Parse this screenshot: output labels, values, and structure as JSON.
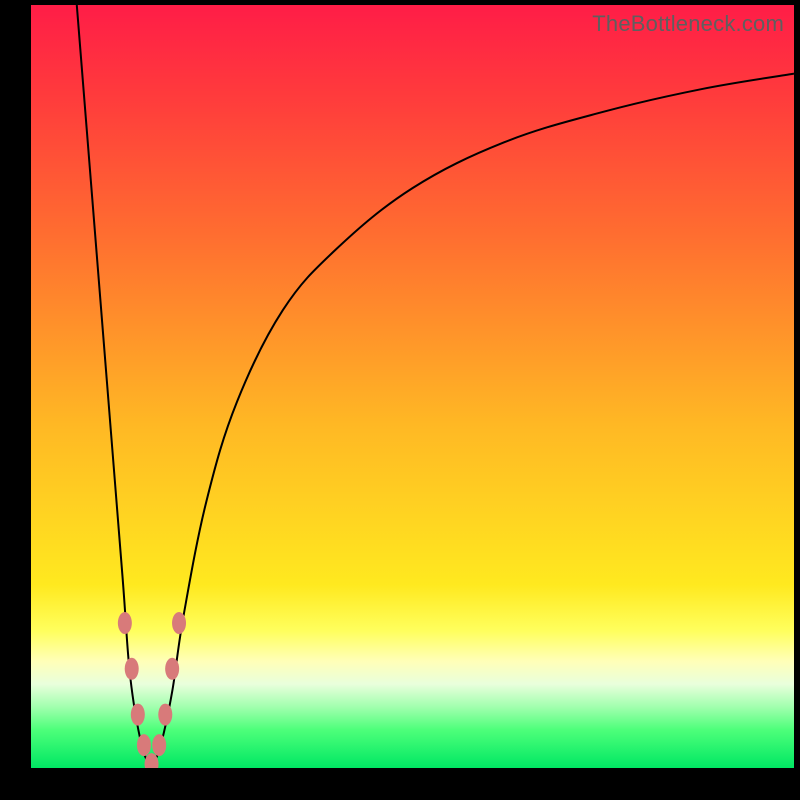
{
  "watermark": "TheBottleneck.com",
  "chart_data": {
    "type": "line",
    "title": "",
    "xlabel": "",
    "ylabel": "",
    "xlim": [
      0,
      100
    ],
    "ylim": [
      0,
      100
    ],
    "grid": false,
    "legend": false,
    "series": [
      {
        "name": "left-branch",
        "x": [
          6,
          8,
          10,
          12,
          13,
          14.5,
          15.8
        ],
        "y": [
          100,
          75,
          50,
          25,
          12,
          3,
          0
        ]
      },
      {
        "name": "right-branch",
        "x": [
          15.8,
          17,
          18.5,
          20,
          23,
          27,
          33,
          40,
          50,
          62,
          75,
          88,
          100
        ],
        "y": [
          0,
          3,
          10,
          20,
          35,
          48,
          60,
          68,
          76,
          82,
          86,
          89,
          91
        ]
      }
    ],
    "markers": {
      "name": "trough-markers",
      "color": "#d87a7a",
      "points": [
        {
          "x": 12.3,
          "y": 19
        },
        {
          "x": 13.2,
          "y": 13
        },
        {
          "x": 14.0,
          "y": 7
        },
        {
          "x": 14.8,
          "y": 3
        },
        {
          "x": 15.8,
          "y": 0.5
        },
        {
          "x": 16.8,
          "y": 3
        },
        {
          "x": 17.6,
          "y": 7
        },
        {
          "x": 18.5,
          "y": 13
        },
        {
          "x": 19.4,
          "y": 19
        }
      ]
    },
    "background_gradient": {
      "top": "#ff1d47",
      "bottom": "#00e763"
    }
  }
}
